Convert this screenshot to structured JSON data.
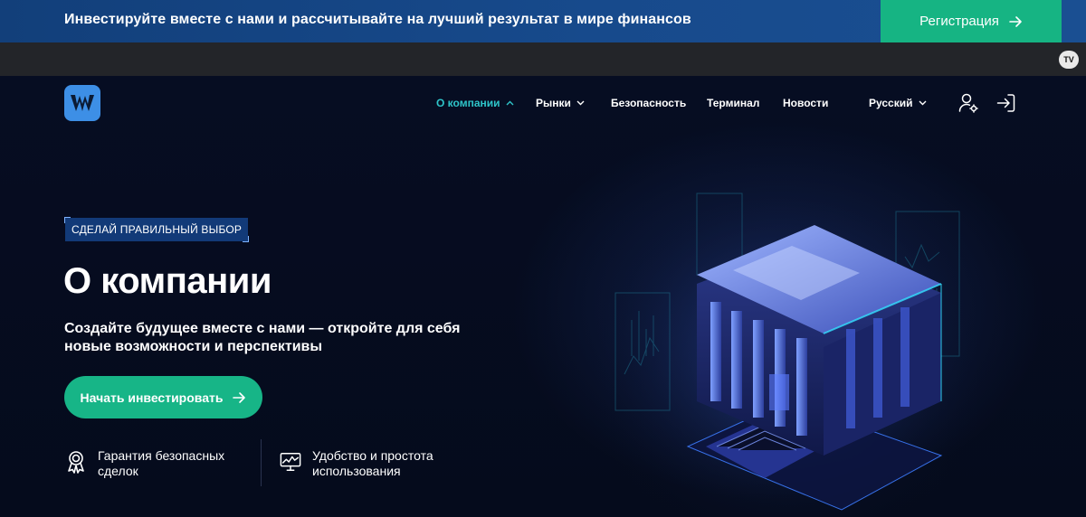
{
  "promo": {
    "text": "Инвестируйте вместе с нами и рассчитывайте на лучший результат в мире финансов",
    "button_label": "Регистрация"
  },
  "strip": {
    "badge": "TV"
  },
  "nav": {
    "items": [
      {
        "label": "О компании",
        "active": true,
        "dropdown": true
      },
      {
        "label": "Рынки",
        "active": false,
        "dropdown": true
      },
      {
        "label": "Безопасность",
        "active": false,
        "dropdown": false
      },
      {
        "label": "Терминал",
        "active": false,
        "dropdown": false
      },
      {
        "label": "Новости",
        "active": false,
        "dropdown": false
      }
    ],
    "language": "Русский",
    "icons": [
      "user-settings-icon",
      "login-icon"
    ]
  },
  "hero": {
    "tag": "СДЕЛАЙ ПРАВИЛЬНЫЙ ВЫБОР",
    "title": "О компании",
    "subtitle": "Создайте будущее вместе с нами — откройте для себя новые возможности и перспективы",
    "cta_label": "Начать инвестировать",
    "features": [
      {
        "icon": "award-badge-icon",
        "text": "Гарантия безопасных сделок"
      },
      {
        "icon": "chart-monitor-icon",
        "text": "Удобство и простота использования"
      }
    ]
  },
  "colors": {
    "accent_green": "#16b483",
    "banner_blue": "#174a8c",
    "active_nav": "#2ec4c9",
    "background": "#050b1c"
  }
}
